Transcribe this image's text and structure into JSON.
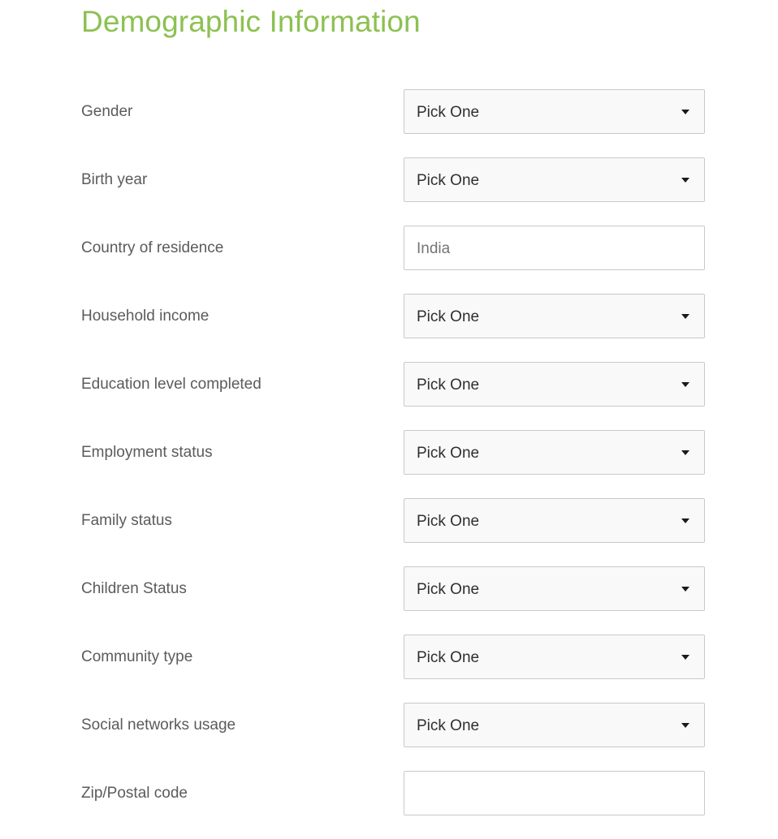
{
  "header": {
    "title": "Demographic Information",
    "title_color": "#8cc152"
  },
  "form": {
    "fields": [
      {
        "label": "Gender",
        "type": "select",
        "value": "Pick One",
        "icon": "chevron-down-icon",
        "name": "gender"
      },
      {
        "label": "Birth year",
        "type": "select",
        "value": "Pick One",
        "icon": "chevron-down-icon",
        "name": "birth-year"
      },
      {
        "label": "Country of residence",
        "type": "text",
        "value": "India",
        "placeholder": "India",
        "name": "country-of-residence"
      },
      {
        "label": "Household income",
        "type": "select",
        "value": "Pick One",
        "icon": "chevron-down-icon",
        "name": "household-income"
      },
      {
        "label": "Education level completed",
        "type": "select",
        "value": "Pick One",
        "icon": "chevron-down-icon",
        "name": "education-level-completed"
      },
      {
        "label": "Employment status",
        "type": "select",
        "value": "Pick One",
        "icon": "chevron-down-icon",
        "name": "employment-status"
      },
      {
        "label": "Family status",
        "type": "select",
        "value": "Pick One",
        "icon": "chevron-down-icon",
        "name": "family-status"
      },
      {
        "label": "Children Status",
        "type": "select",
        "value": "Pick One",
        "icon": "chevron-down-icon",
        "name": "children-status"
      },
      {
        "label": "Community type",
        "type": "select",
        "value": "Pick One",
        "icon": "chevron-down-icon",
        "name": "community-type"
      },
      {
        "label": "Social networks usage",
        "type": "select",
        "value": "Pick One",
        "icon": "chevron-down-icon",
        "name": "social-networks-usage"
      },
      {
        "label": "Zip/Postal code",
        "type": "text",
        "value": "",
        "placeholder": "",
        "name": "zip-postal-code"
      }
    ]
  },
  "colors": {
    "label_text": "#5a5b5d",
    "select_background": "#f9f9f9",
    "input_background": "#ffffff",
    "border": "#c9c9c9",
    "value_text": "#2f2f2f",
    "placeholder_text": "#757575"
  }
}
